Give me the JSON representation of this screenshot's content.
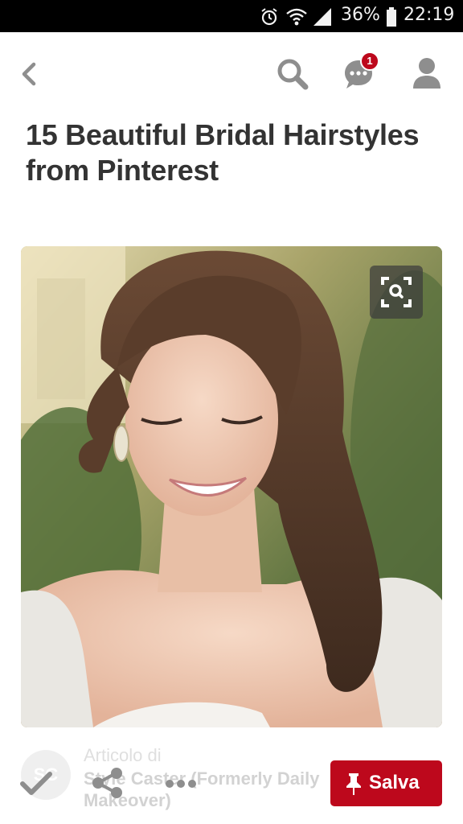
{
  "status_bar": {
    "battery": "36%",
    "time": "22:19",
    "icons": [
      "alarm-icon",
      "wifi-icon",
      "signal-icon",
      "battery-icon"
    ]
  },
  "header": {
    "icons": [
      "back-arrow-icon",
      "search-icon",
      "messages-icon",
      "profile-icon"
    ],
    "notification_count": "1"
  },
  "pin": {
    "title": "15 Beautiful Bridal Hairstyles from Pinterest",
    "image_icon": "visual-search-icon"
  },
  "attribution": {
    "label": "Articolo di",
    "source": "Style Caster (Formerly Daily Makeover)",
    "avatar_text": "SC"
  },
  "actions": {
    "icons": [
      "check-icon",
      "share-icon",
      "more-icon",
      "pin-icon"
    ],
    "save_label": "Salva"
  },
  "colors": {
    "brand_red": "#bd081c",
    "icon_gray": "#8e8e8e",
    "title_text": "#333333"
  }
}
